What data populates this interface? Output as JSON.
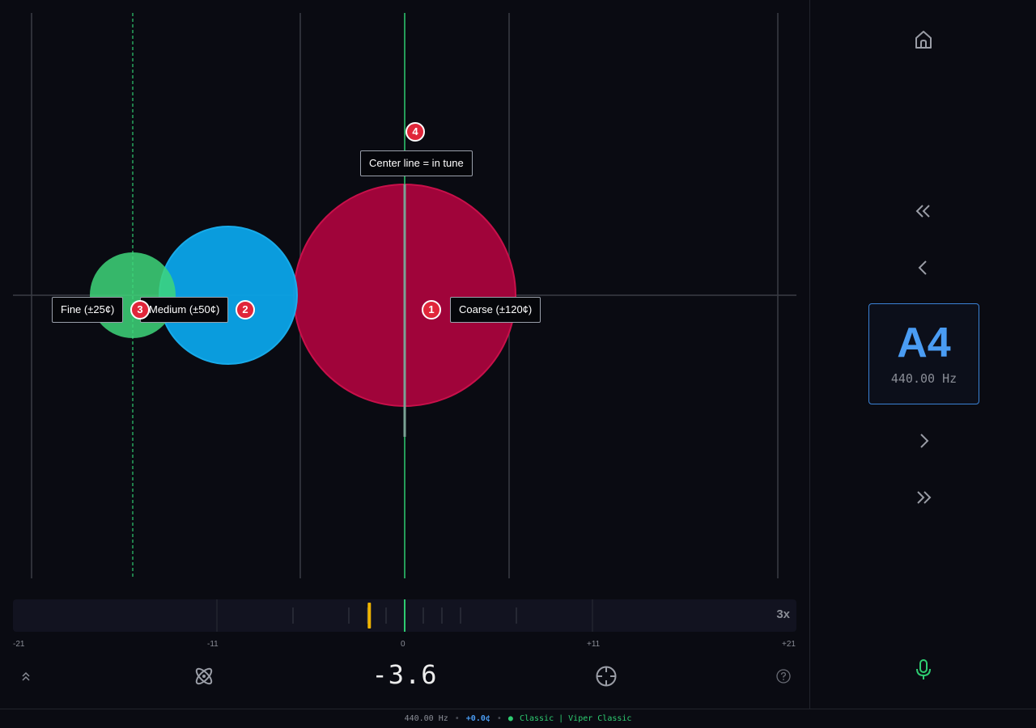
{
  "annotations": [
    {
      "number": "1",
      "label": "Coarse (±120¢)"
    },
    {
      "number": "2",
      "label": "Medium (±50¢)"
    },
    {
      "number": "3",
      "label": "Fine (±25¢)"
    },
    {
      "number": "4",
      "label": "Center line = in tune"
    }
  ],
  "meter": {
    "zoom": "3x",
    "scale_labels": [
      "-21",
      "-11",
      "0",
      "+11",
      "+21"
    ],
    "range": [
      -21,
      21
    ],
    "needle_value": -3.6
  },
  "readout": {
    "cents": "-3.6"
  },
  "note": {
    "name": "A4",
    "frequency": "440.00 Hz"
  },
  "status": {
    "frequency": "440.00 Hz",
    "cents": "+0.0¢",
    "dot": "●",
    "preset": "Classic | Viper Classic"
  },
  "icons": {
    "home": "home-icon",
    "double_left": "chevrons-left-icon",
    "left": "chevron-left-icon",
    "right": "chevron-right-icon",
    "double_right": "chevrons-right-icon",
    "mic": "microphone-icon",
    "collapse": "chevrons-up-icon",
    "atom": "atom-icon",
    "target": "crosshair-icon",
    "help": "help-circle-icon"
  },
  "colors": {
    "coarse": "#a0043a",
    "medium": "#0aa4e8",
    "fine": "#3ed67a",
    "in_tune": "#2ecc71",
    "needle": "#f0b400",
    "accent": "#4a9cf3",
    "badge": "#e0263a"
  }
}
